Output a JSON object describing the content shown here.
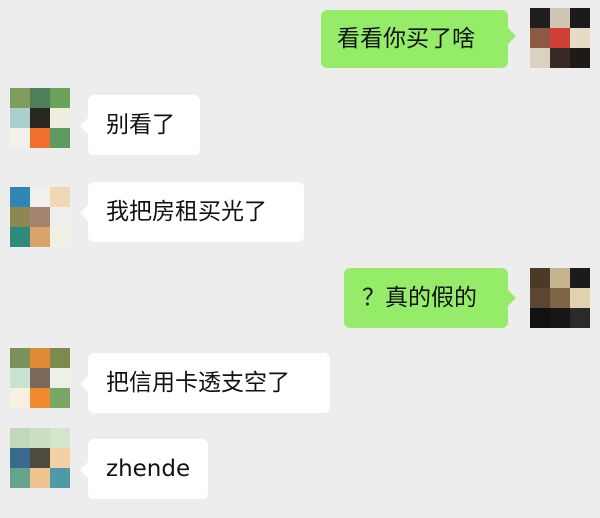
{
  "chat": {
    "messages": [
      {
        "id": 1,
        "sender": "me",
        "text": "看看你买了啥",
        "avatar_colors": [
          "#1e1f1c",
          "#cfc7b4",
          "#1b1b1b",
          "#8c5a42",
          "#cf3f35",
          "#e6dcc6",
          "#d9d2c2",
          "#3a2a26",
          "#1f1a15"
        ]
      },
      {
        "id": 2,
        "sender": "friend",
        "text": "别看了",
        "avatar_colors": [
          "#7f9c5c",
          "#4d7f5a",
          "#6aa25a",
          "#aacfcf",
          "#2a2723",
          "#f1eee0",
          "#f4f1ea",
          "#f06f2f",
          "#5f9b61"
        ]
      },
      {
        "id": 3,
        "sender": "friend",
        "text": "我把房租买光了",
        "avatar_colors": [
          "#2e88b3",
          "#f1f0ec",
          "#f2d7b4",
          "#8d8751",
          "#a48470",
          "#eeeeea",
          "#2e8a7a",
          "#dba36c",
          "#f1f0e4"
        ]
      },
      {
        "id": 4,
        "sender": "me",
        "text": "？真的假的",
        "avatar_colors": [
          "#4a3a27",
          "#c5b48d",
          "#1b1b1b",
          "#5a4631",
          "#7d6648",
          "#dfd2ad",
          "#111111",
          "#161616",
          "#2a2a2a"
        ]
      },
      {
        "id": 5,
        "sender": "friend",
        "text": "把信用卡透支空了",
        "avatar_colors": [
          "#79915a",
          "#e08a38",
          "#7d8a4e",
          "#c9e2d1",
          "#7b6a5c",
          "#eef0e8",
          "#f8f1e2",
          "#ef8a2f",
          "#78a765"
        ]
      },
      {
        "id": 6,
        "sender": "friend",
        "text": "zhende",
        "avatar_colors": [
          "#bfd9ba",
          "#cbe0c3",
          "#d3e5cb",
          "#3a6b8f",
          "#4d4a3f",
          "#f4d1a4",
          "#66a38d",
          "#f0c391",
          "#4e9aa6"
        ]
      }
    ]
  },
  "colors": {
    "background": "#ededed",
    "incoming_bubble": "#ffffff",
    "outgoing_bubble": "#95ec69",
    "text": "#111111"
  }
}
